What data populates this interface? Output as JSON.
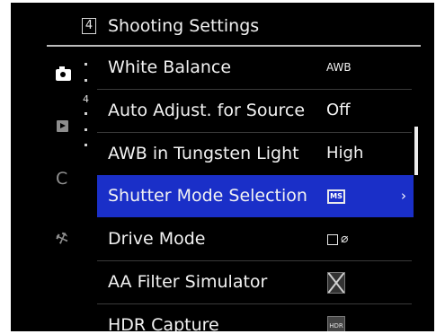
{
  "header": {
    "tab_number": "4",
    "title": "Shooting Settings"
  },
  "sidebar": {
    "page_number": "4",
    "items": [
      {
        "icon": "camera-icon",
        "active": true
      },
      {
        "icon": "playback-icon",
        "active": false
      },
      {
        "icon": "custom-icon",
        "label": "C",
        "active": false
      },
      {
        "icon": "wrench-icon",
        "label": "⚒",
        "active": false
      }
    ]
  },
  "menu": {
    "rows": [
      {
        "label": "White Balance",
        "value": "AWB"
      },
      {
        "label": "Auto Adjust. for Source",
        "value": "Off"
      },
      {
        "label": "AWB in Tungsten Light",
        "value": "High"
      },
      {
        "label": "Shutter Mode Selection",
        "value_icon": "MS",
        "selected": true,
        "chevron": "›"
      },
      {
        "label": "Drive Mode",
        "value_icon": "drive-single-wifi-icon"
      },
      {
        "label": "AA Filter Simulator",
        "value_icon": "aa-filter-off-icon"
      },
      {
        "label": "HDR Capture",
        "value_icon": "HDR"
      }
    ]
  },
  "colors": {
    "selection": "#1a2fc8",
    "background": "#000000",
    "text": "#f2f2f2"
  }
}
